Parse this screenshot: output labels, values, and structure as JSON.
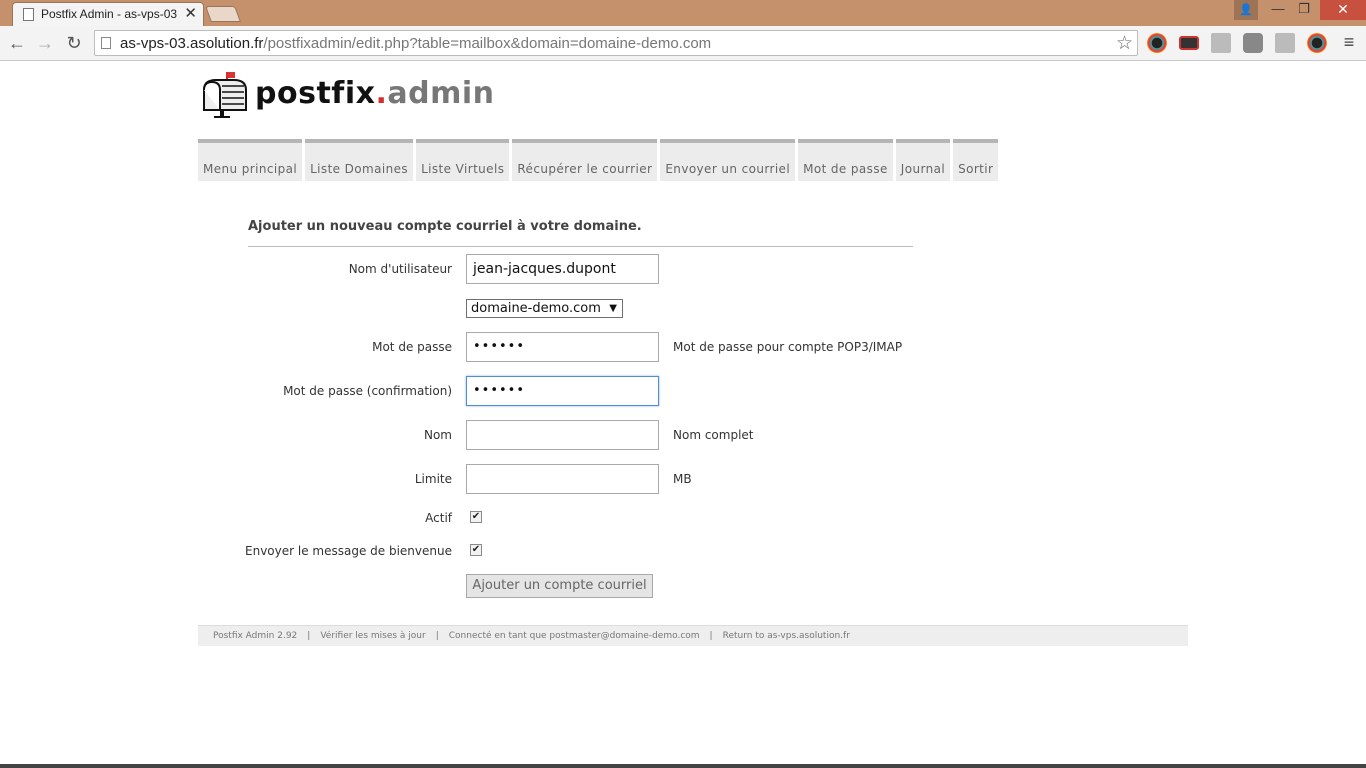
{
  "browser": {
    "tab_title": "Postfix Admin - as-vps-03",
    "url_host": "as-vps-03.asolution.fr",
    "url_path": "/postfixadmin/edit.php?table=mailbox&domain=domaine-demo.com"
  },
  "logo": {
    "name": "postfix",
    "dot": ".",
    "suffix": "admin"
  },
  "menu": [
    {
      "label": "Menu principal"
    },
    {
      "label": "Liste Domaines"
    },
    {
      "label": "Liste Virtuels"
    },
    {
      "label": "Récupérer le courrier"
    },
    {
      "label": "Envoyer un courriel"
    },
    {
      "label": "Mot de passe"
    },
    {
      "label": "Journal"
    },
    {
      "label": "Sortir"
    }
  ],
  "form": {
    "title": "Ajouter un nouveau compte courriel à votre domaine.",
    "username_label": "Nom d'utilisateur",
    "username_value": "jean-jacques.dupont",
    "domain_value": "domaine-demo.com",
    "password_label": "Mot de passe",
    "password_value": "••••••",
    "password_hint": "Mot de passe pour compte POP3/IMAP",
    "password2_label": "Mot de passe (confirmation)",
    "password2_value": "••••••",
    "name_label": "Nom",
    "name_value": "",
    "name_hint": "Nom complet",
    "quota_label": "Limite",
    "quota_value": "",
    "quota_hint": "MB",
    "active_label": "Actif",
    "active_checked": true,
    "welcome_label": "Envoyer le message de bienvenue",
    "welcome_checked": true,
    "submit_label": "Ajouter un compte courriel"
  },
  "footer": {
    "version": "Postfix Admin 2.92",
    "check_updates": "Vérifier les mises à jour",
    "logged_in": "Connecté en tant que postmaster@domaine-demo.com",
    "return_link": "Return to as-vps.asolution.fr",
    "separator": "|"
  },
  "icons": {
    "back": "arrow-left-icon",
    "forward": "arrow-right-icon",
    "reload": "reload-icon",
    "bookmark": "star-icon",
    "menu": "hamburger-icon"
  }
}
